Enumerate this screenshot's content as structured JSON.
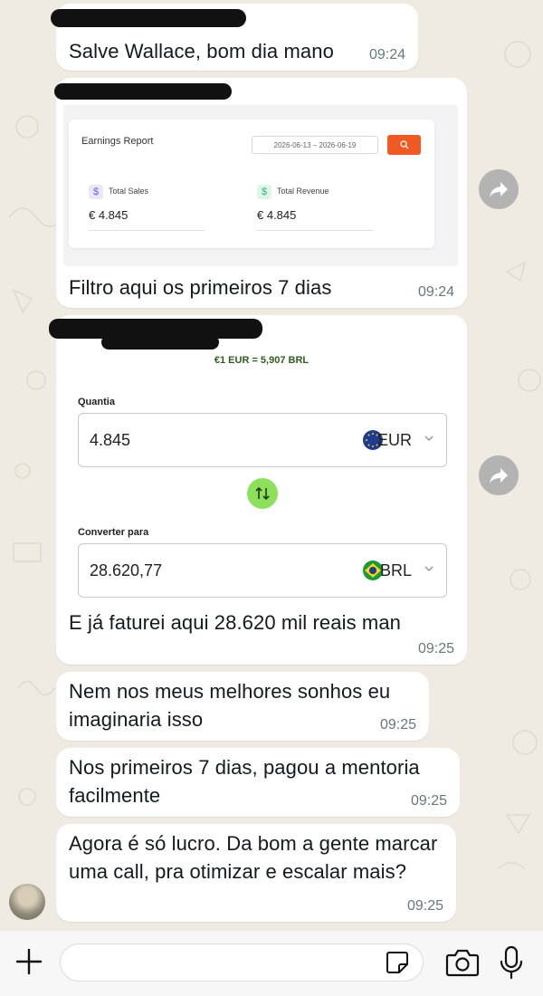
{
  "messages": [
    {
      "text": "Salve Wallace, bom dia mano",
      "time": "09:24"
    },
    {
      "text": "Filtro aqui os primeiros 7 dias",
      "time": "09:24"
    },
    {
      "text": "E já faturei aqui 28.620 mil reais man",
      "time": "09:25"
    },
    {
      "text": "Nem nos meus melhores sonhos eu imaginaria isso",
      "time": "09:25"
    },
    {
      "text": "Nos primeiros 7 dias, pagou a mentoria facilmente",
      "time": "09:25"
    },
    {
      "text": "Agora é só lucro. Da bom a gente marcar uma call, pra otimizar e escalar mais?",
      "time": "09:25"
    }
  ],
  "earnings_report": {
    "title": "Earnings Report",
    "date_range": "2026-06-13 – 2026-06-19",
    "stats": [
      {
        "label": "Total Sales",
        "value": "€ 4.845",
        "icon": "dollar-icon",
        "color": "#7a5cc8"
      },
      {
        "label": "Total Revenue",
        "value": "€ 4.845",
        "icon": "dollar-icon",
        "color": "#2bb673"
      }
    ],
    "accent_color": "#f05a22"
  },
  "converter": {
    "rate": "€1 EUR = 5,907 BRL",
    "amount_label": "Quantia",
    "amount_value": "4.845",
    "from_currency": "EUR",
    "convert_label": "Converter para",
    "converted_value": "28.620,77",
    "to_currency": "BRL"
  },
  "input_bar": {
    "placeholder": ""
  },
  "colors": {
    "chat_background": "#efeae2",
    "bubble": "#ffffff",
    "timestamp": "#667781",
    "swap_button": "#8de05c"
  }
}
